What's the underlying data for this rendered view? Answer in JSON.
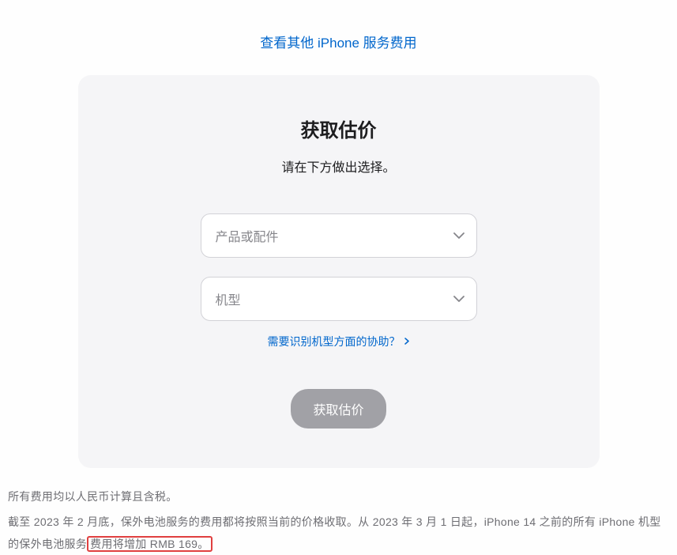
{
  "topLink": {
    "text": "查看其他 iPhone 服务费用"
  },
  "card": {
    "title": "获取估价",
    "subtitle": "请在下方做出选择。",
    "selectProduct": {
      "placeholder": "产品或配件"
    },
    "selectModel": {
      "placeholder": "机型"
    },
    "helpLink": {
      "text": "需要识别机型方面的协助？"
    },
    "submitButton": {
      "label": "获取估价"
    }
  },
  "notes": {
    "line1": "所有费用均以人民币计算且含税。",
    "line2_part1": "截至 2023 年 2 月底，保外电池服务的费用都将按照当前的价格收取。从 2023 年 3 月 1 日起，iPhone 14 之前的所有 iPhone 机型的保外电池服务",
    "line2_highlight": "费用将增加 RMB 169。"
  }
}
